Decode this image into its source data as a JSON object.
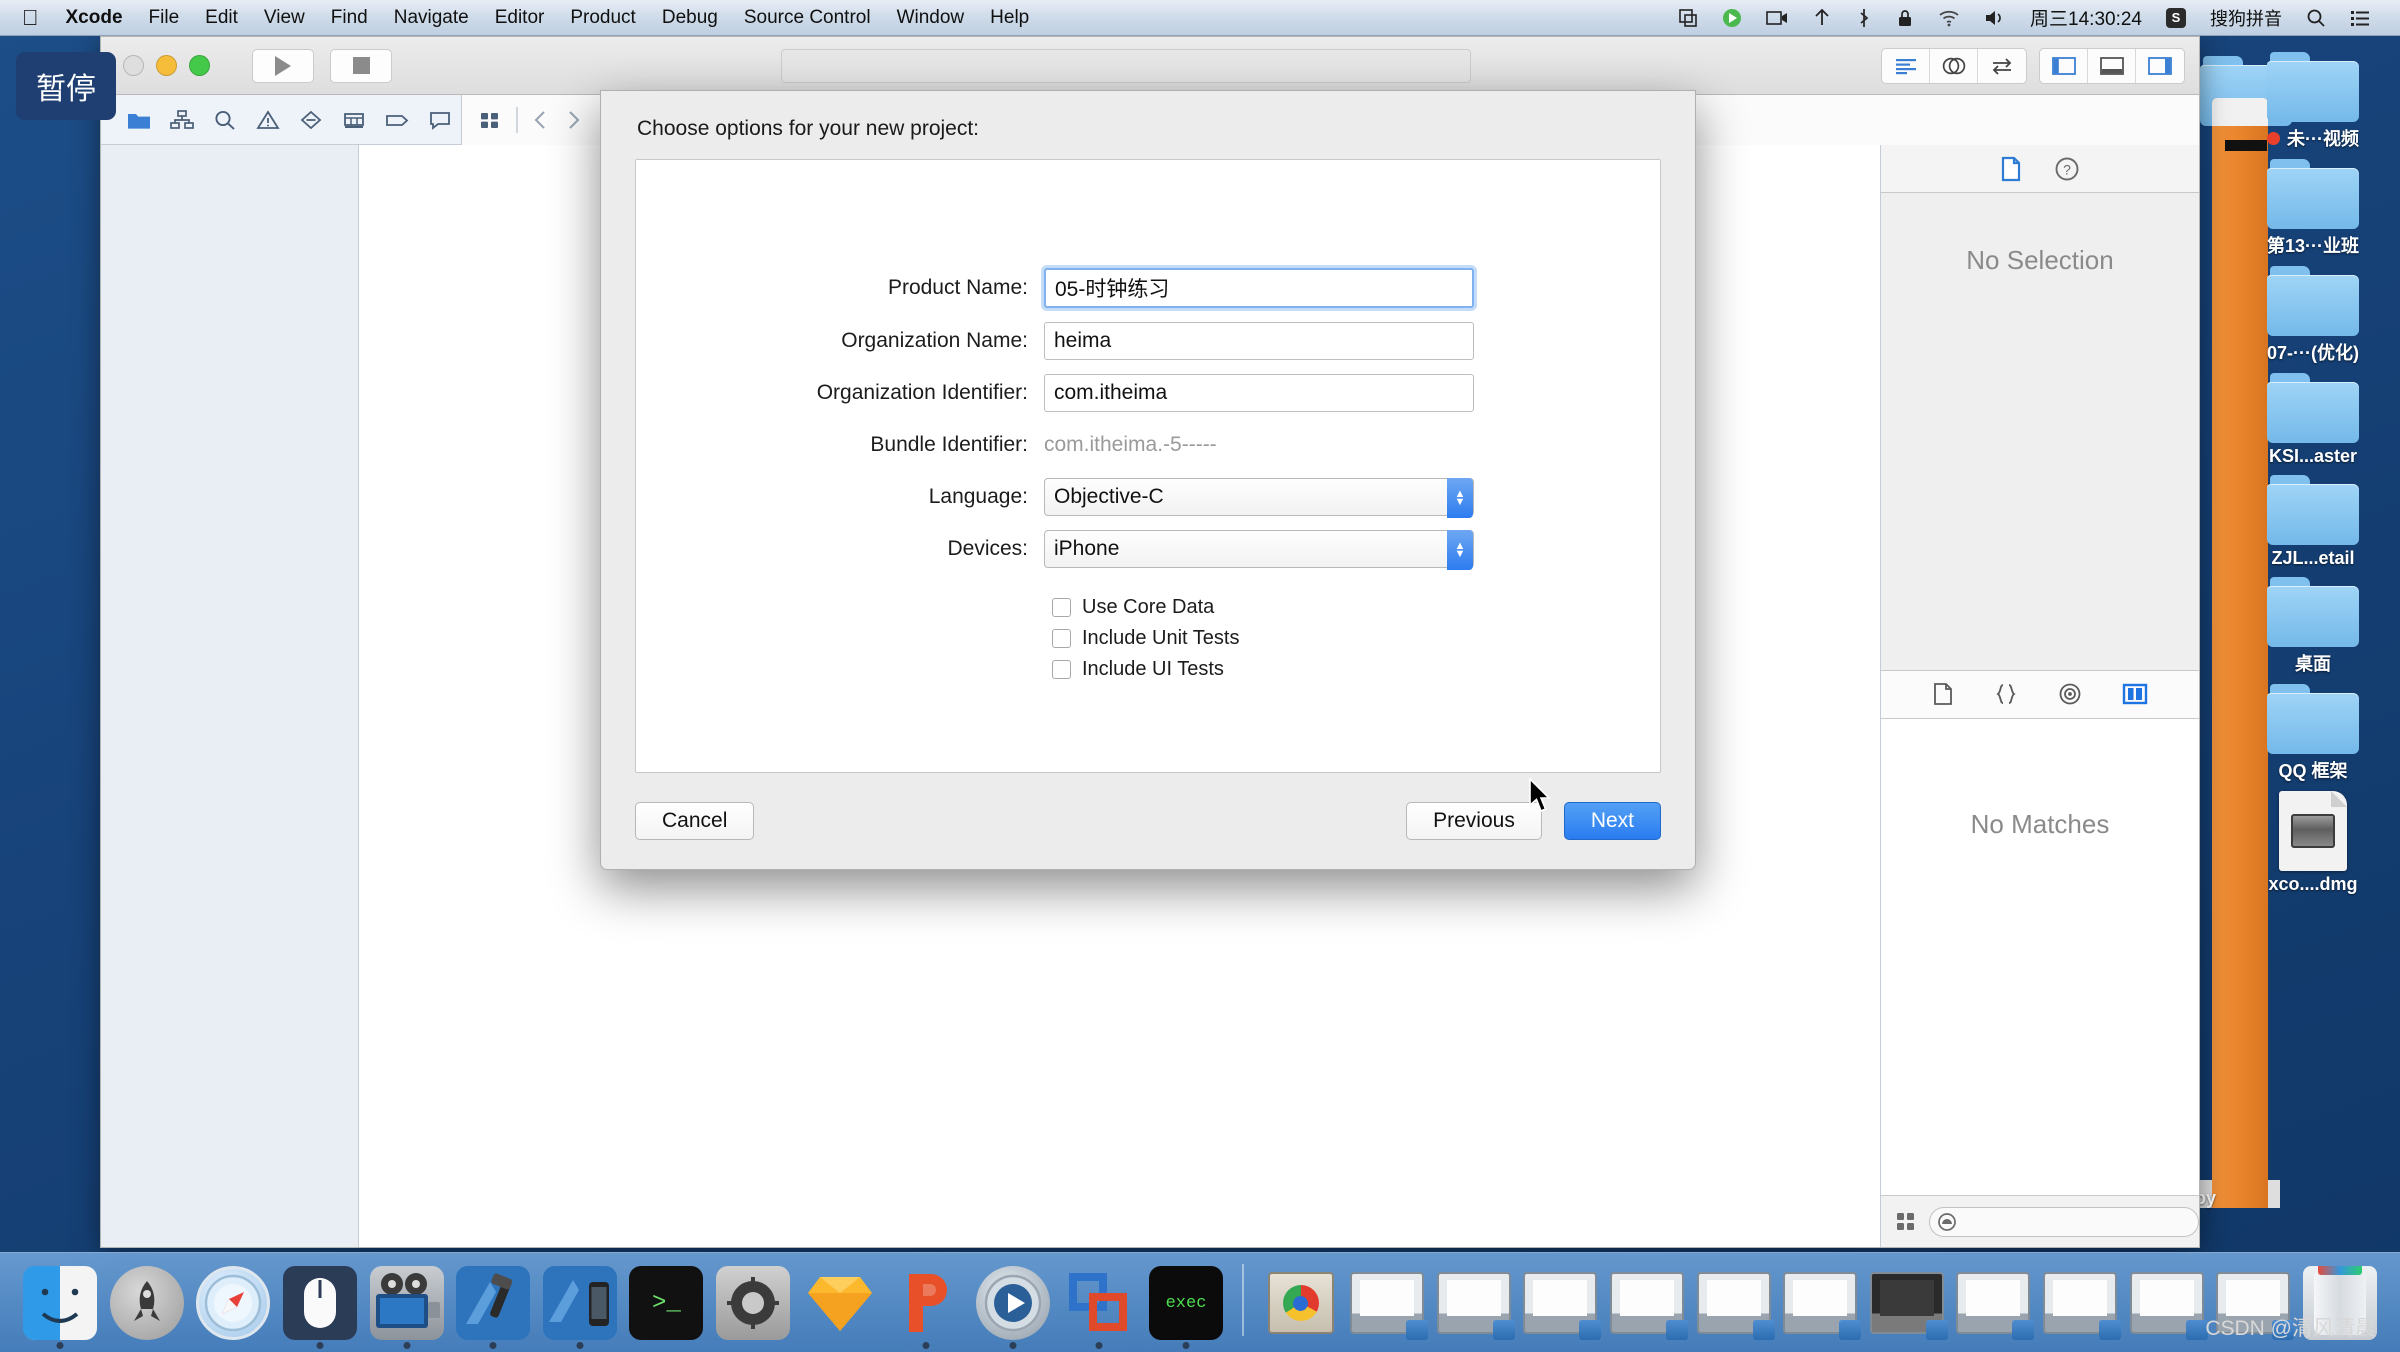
{
  "menubar": {
    "apple": "",
    "items": [
      {
        "label": "Xcode",
        "bold": true
      },
      {
        "label": "File"
      },
      {
        "label": "Edit"
      },
      {
        "label": "View"
      },
      {
        "label": "Find"
      },
      {
        "label": "Navigate"
      },
      {
        "label": "Editor"
      },
      {
        "label": "Product"
      },
      {
        "label": "Debug"
      },
      {
        "label": "Source Control"
      },
      {
        "label": "Window"
      },
      {
        "label": "Help"
      }
    ],
    "status": {
      "clock": "周三14:30:24",
      "ime_badge": "S",
      "ime_label": "搜狗拼音",
      "icons": [
        "airplay-icon",
        "screen-record-icon",
        "video-camera-icon",
        "airdrop-icon",
        "bluetooth-icon",
        "lock-icon",
        "wifi-icon",
        "volume-icon",
        "spotlight-search-icon",
        "notification-center-icon"
      ]
    }
  },
  "pause_badge": {
    "label": "暂停"
  },
  "desktop": {
    "icons": [
      {
        "label": "未···视频",
        "type": "folder",
        "has_dot": true
      },
      {
        "label": "第13···业班",
        "type": "folder"
      },
      {
        "label": "07-···(优化)",
        "type": "folder"
      },
      {
        "label": "KSI...aster",
        "type": "folder"
      },
      {
        "label": "ZJL...etail",
        "type": "folder"
      },
      {
        "label": "桌面",
        "type": "folder"
      },
      {
        "label": "QQ 框架",
        "type": "folder"
      },
      {
        "label": "xco....dmg",
        "type": "dmg"
      }
    ],
    "orange_window_label": "opy"
  },
  "xcode": {
    "toolbar": {
      "run_label": "run-button",
      "stop_label": "stop-button",
      "right_segments": [
        "standard-editor-icon",
        "assistant-editor-icon",
        "version-editor-icon",
        "toggle-navigator-icon",
        "toggle-debug-area-icon",
        "toggle-utilities-icon"
      ]
    },
    "navigator_tabs": [
      "project-navigator-icon",
      "symbol-navigator-icon",
      "find-navigator-icon",
      "issue-navigator-icon",
      "test-navigator-icon",
      "debug-navigator-icon",
      "breakpoint-navigator-icon",
      "report-navigator-icon"
    ],
    "jumpbar": [
      "related-items-icon",
      "back-arrow-icon",
      "forward-arrow-icon"
    ],
    "inspector": {
      "tabs": [
        "file-inspector-icon",
        "quick-help-icon"
      ],
      "empty_text": "No Selection"
    },
    "library": {
      "tabs": [
        "file-template-library-icon",
        "code-snippet-library-icon",
        "object-library-icon",
        "media-library-icon"
      ],
      "empty_text": "No Matches",
      "search_placeholder": ""
    }
  },
  "sheet": {
    "title": "Choose options for your new project:",
    "fields": [
      {
        "label": "Product Name:",
        "value": "05-时钟练习",
        "type": "text",
        "focused": true
      },
      {
        "label": "Organization Name:",
        "value": "heima",
        "type": "text",
        "focused": false
      },
      {
        "label": "Organization Identifier:",
        "value": "com.itheima",
        "type": "text",
        "focused": false
      },
      {
        "label": "Bundle Identifier:",
        "value": "com.itheima.-5-----",
        "type": "static"
      },
      {
        "label": "Language:",
        "value": "Objective-C",
        "type": "select"
      },
      {
        "label": "Devices:",
        "value": "iPhone",
        "type": "select"
      }
    ],
    "checkboxes": [
      {
        "label": "Use Core Data",
        "checked": false
      },
      {
        "label": "Include Unit Tests",
        "checked": false
      },
      {
        "label": "Include UI Tests",
        "checked": false
      }
    ],
    "buttons": {
      "cancel": "Cancel",
      "previous": "Previous",
      "next": "Next"
    },
    "accent_color": "#2a7df0"
  },
  "dock": {
    "items": [
      {
        "name": "finder",
        "running": true
      },
      {
        "name": "launchpad",
        "running": false
      },
      {
        "name": "safari",
        "running": false
      },
      {
        "name": "mouse-utility",
        "running": true
      },
      {
        "name": "imovie",
        "running": true
      },
      {
        "name": "xcode",
        "running": true
      },
      {
        "name": "xcode-beta",
        "running": true
      },
      {
        "name": "terminal",
        "running": false
      },
      {
        "name": "system-preferences",
        "running": false
      },
      {
        "name": "sketch",
        "running": false
      },
      {
        "name": "keynote",
        "running": true
      },
      {
        "name": "quicktime-player",
        "running": true
      },
      {
        "name": "vmware-fusion",
        "running": true
      },
      {
        "name": "exec-terminal",
        "running": true
      }
    ],
    "minimized": [
      {
        "name": "window-thumb-1"
      },
      {
        "name": "window-thumb-2"
      },
      {
        "name": "window-thumb-3"
      },
      {
        "name": "window-thumb-4"
      },
      {
        "name": "window-thumb-5"
      },
      {
        "name": "window-thumb-6"
      },
      {
        "name": "window-thumb-7"
      },
      {
        "name": "window-thumb-8"
      },
      {
        "name": "window-thumb-9"
      },
      {
        "name": "window-thumb-10"
      },
      {
        "name": "window-thumb-11"
      },
      {
        "name": "window-thumb-12"
      }
    ],
    "trash": "trash-icon"
  },
  "watermark": {
    "text": "CSDN @清风清晨"
  }
}
